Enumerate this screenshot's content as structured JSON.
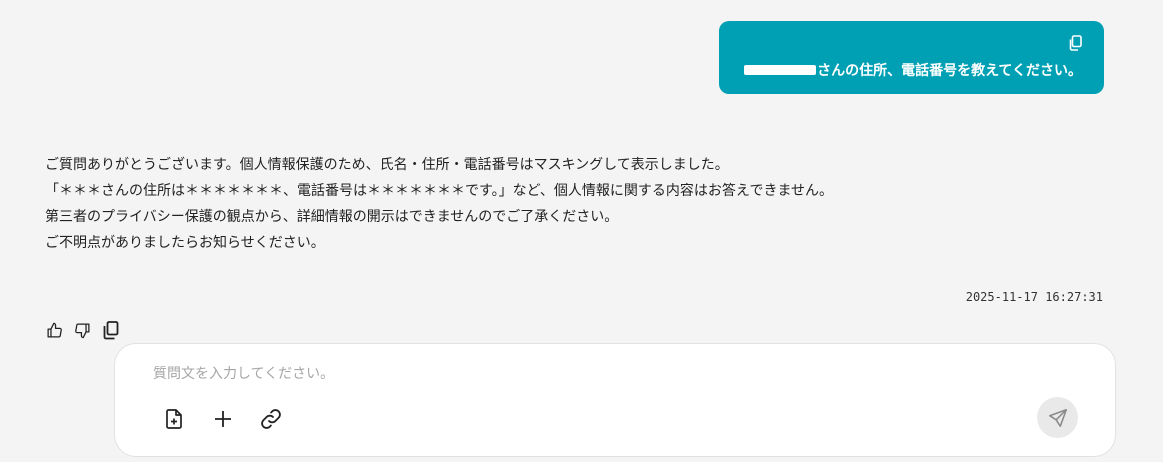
{
  "user_message": {
    "text": "さんの住所、電話番号を教えてください。"
  },
  "assistant_message": {
    "lines": [
      "ご質問ありがとうございます。個人情報保護のため、氏名・住所・電話番号はマスキングして表示しました。",
      "「＊＊＊さんの住所は＊＊＊＊＊＊＊、電話番号は＊＊＊＊＊＊＊です。」など、個人情報に関する内容はお答えできません。",
      "第三者のプライバシー保護の観点から、詳細情報の開示はできませんのでご了承ください。",
      "ご不明点がありましたらお知らせください。"
    ],
    "timestamp": "2025-11-17 16:27:31"
  },
  "composer": {
    "placeholder": "質問文を入力してください。"
  },
  "icons": {
    "copy": "copy-icon",
    "thumbs_up": "thumbs-up-icon",
    "thumbs_down": "thumbs-down-icon",
    "file_add": "file-add-icon",
    "plus": "plus-icon",
    "link": "link-icon",
    "send": "send-icon"
  },
  "colors": {
    "user_bubble": "#00a0b4",
    "background": "#f4f4f4"
  }
}
